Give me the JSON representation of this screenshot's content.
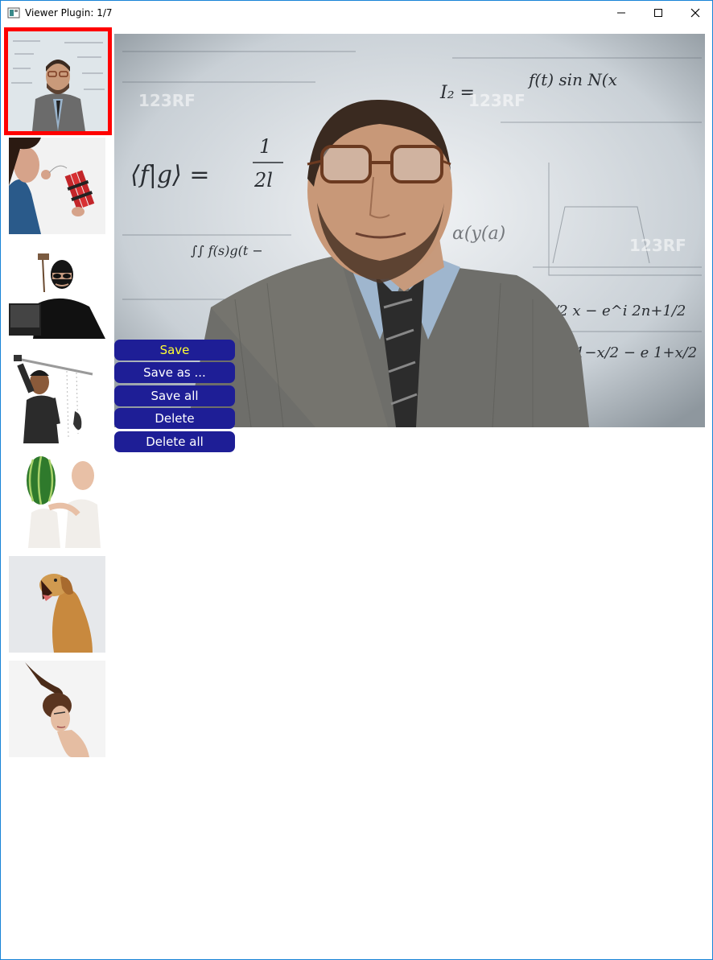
{
  "window": {
    "title": "Viewer Plugin: 1/7",
    "controls": {
      "minimize": "minimize-icon",
      "maximize": "maximize-icon",
      "close": "close-icon"
    }
  },
  "thumbnails": [
    {
      "label": "thumbnail-man-glasses-formulas",
      "selected": true
    },
    {
      "label": "thumbnail-woman-dynamite"
    },
    {
      "label": "thumbnail-masked-burglar"
    },
    {
      "label": "thumbnail-man-sword-phone"
    },
    {
      "label": "thumbnail-man-watermelon"
    },
    {
      "label": "thumbnail-dog-yawning"
    },
    {
      "label": "thumbnail-woman-horn-hair"
    }
  ],
  "image_text": {
    "formula_fg": "⟨f|g⟩ =",
    "formula_frac_num": "1",
    "formula_frac_den": "2l",
    "formula_i2": "I₂ =",
    "formula_sin": "f(t) sin N(x",
    "formula_exp1": "−i 2n+1/2 x − e^i 2n+1/2",
    "formula_exp2": "e −i 1−x/2 − e 1+x/2",
    "formula_alpha": "α(y(a)",
    "formula_int": "∫∫ f(s)g(t −",
    "watermark": "123RF"
  },
  "actions": {
    "save": "Save",
    "save_as": "Save as ...",
    "save_all": "Save all",
    "delete": "Delete",
    "delete_all": "Delete all"
  },
  "colors": {
    "accent_button": "#1e1e96",
    "active_text": "#ffff33",
    "selection_border": "#ff0000",
    "window_border": "#1883d7"
  }
}
